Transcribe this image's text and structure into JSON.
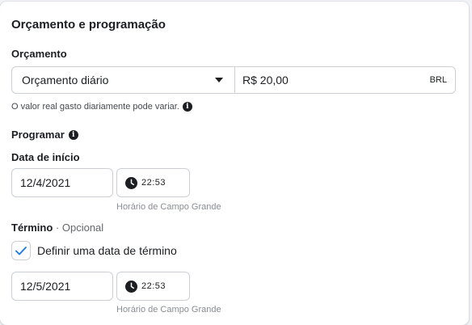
{
  "section_title": "Orçamento e programação",
  "budget": {
    "label": "Orçamento",
    "type_value": "Orçamento diário",
    "amount": "R$ 20,00",
    "currency": "BRL",
    "hint": "O valor real gasto diariamente pode variar."
  },
  "schedule": {
    "label": "Programar",
    "start": {
      "label": "Data de início",
      "date": "12/4/2021",
      "time": "22:53",
      "timezone": "Horário de Campo Grande"
    },
    "end": {
      "label": "Término",
      "optional": "· Opcional",
      "checkbox_label": "Definir uma data de término",
      "checked": true,
      "date": "12/5/2021",
      "time": "22:53",
      "timezone": "Horário de Campo Grande"
    }
  },
  "colors": {
    "accent": "#1877f2",
    "border": "#ccd0d5"
  }
}
